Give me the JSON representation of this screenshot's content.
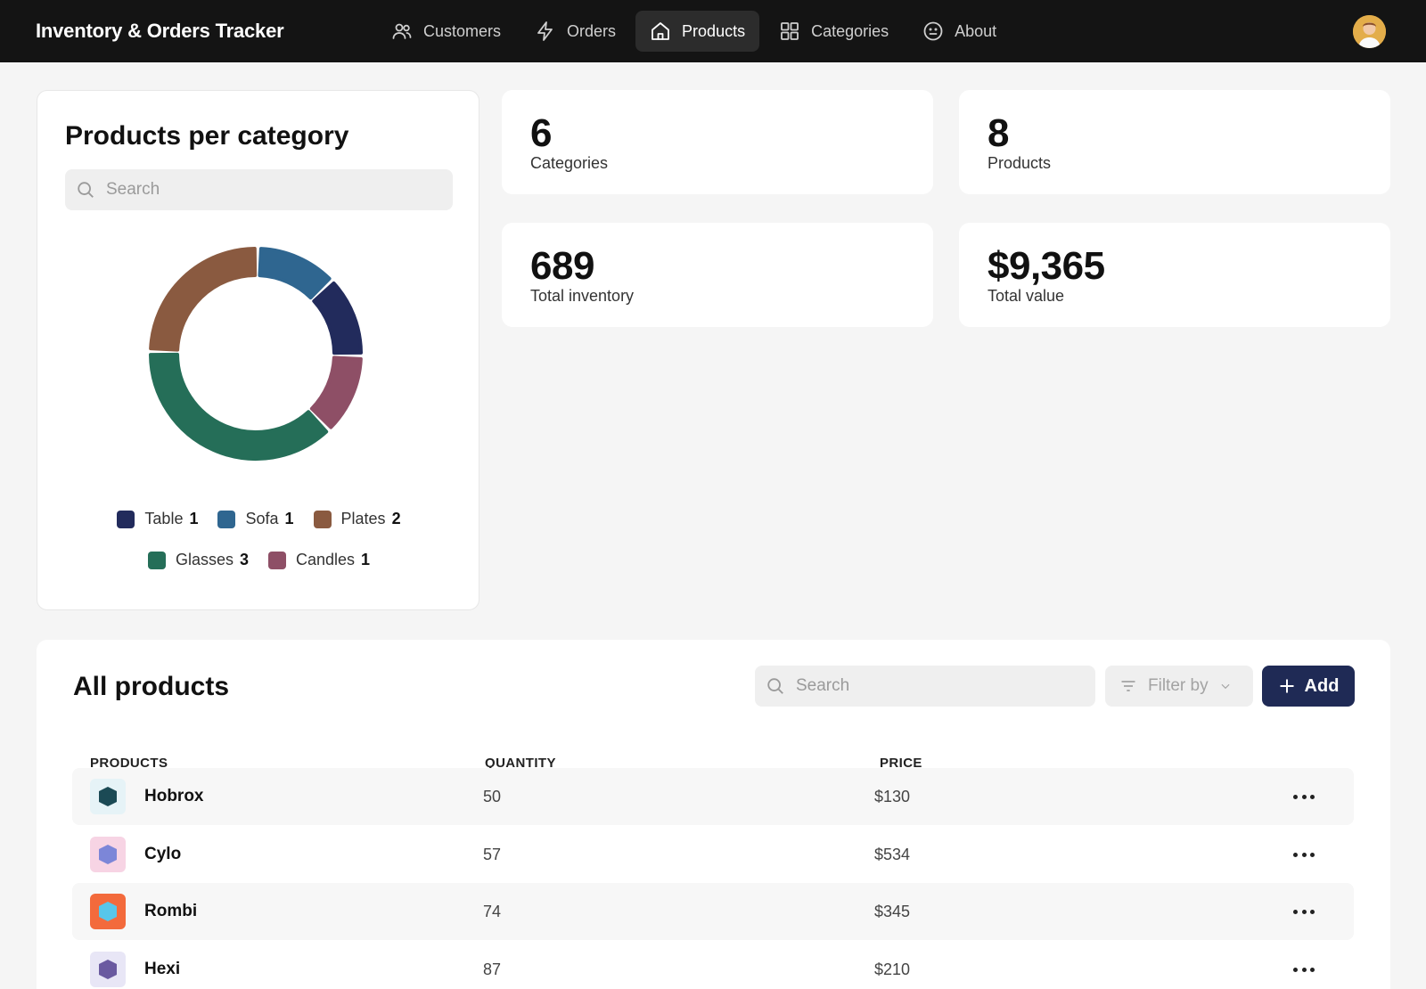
{
  "app": {
    "title": "Inventory & Orders Tracker"
  },
  "nav": [
    {
      "label": "Customers",
      "icon": "users-icon",
      "active": false
    },
    {
      "label": "Orders",
      "icon": "lightning-icon",
      "active": false
    },
    {
      "label": "Products",
      "icon": "home-icon",
      "active": true
    },
    {
      "label": "Categories",
      "icon": "grid-icon",
      "active": false
    },
    {
      "label": "About",
      "icon": "smiley-icon",
      "active": false
    }
  ],
  "chart_panel": {
    "title": "Products per category",
    "search_placeholder": "Search"
  },
  "chart_data": {
    "type": "pie",
    "style": "donut",
    "title": "Products per category",
    "slices": [
      {
        "label": "Table",
        "value": 1,
        "color": "#222b5c"
      },
      {
        "label": "Sofa",
        "value": 1,
        "color": "#2f6690"
      },
      {
        "label": "Plates",
        "value": 2,
        "color": "#8a5a40"
      },
      {
        "label": "Glasses",
        "value": 3,
        "color": "#256e58"
      },
      {
        "label": "Candles",
        "value": 1,
        "color": "#8e4f66"
      }
    ]
  },
  "stats": [
    {
      "value": "6",
      "label": "Categories"
    },
    {
      "value": "8",
      "label": "Products"
    },
    {
      "value": "689",
      "label": "Total inventory"
    },
    {
      "value": "$9,365",
      "label": "Total value"
    }
  ],
  "products": {
    "title": "All products",
    "search_placeholder": "Search",
    "filter_label": "Filter by",
    "add_label": "Add",
    "columns": [
      "PRODUCTS",
      "QUANTITY",
      "PRICE"
    ],
    "rows": [
      {
        "name": "Hobrox",
        "quantity": "50",
        "price": "$130",
        "thumb_bg": "#e6f3f7",
        "thumb_fg": "#1b4a55"
      },
      {
        "name": "Cylo",
        "quantity": "57",
        "price": "$534",
        "thumb_bg": "#f7d4e4",
        "thumb_fg": "#7c86d8"
      },
      {
        "name": "Rombi",
        "quantity": "74",
        "price": "$345",
        "thumb_bg": "#f36a3c",
        "thumb_fg": "#57c6ea"
      },
      {
        "name": "Hexi",
        "quantity": "87",
        "price": "$210",
        "thumb_bg": "#e8e6f6",
        "thumb_fg": "#6a5aa0"
      }
    ]
  }
}
